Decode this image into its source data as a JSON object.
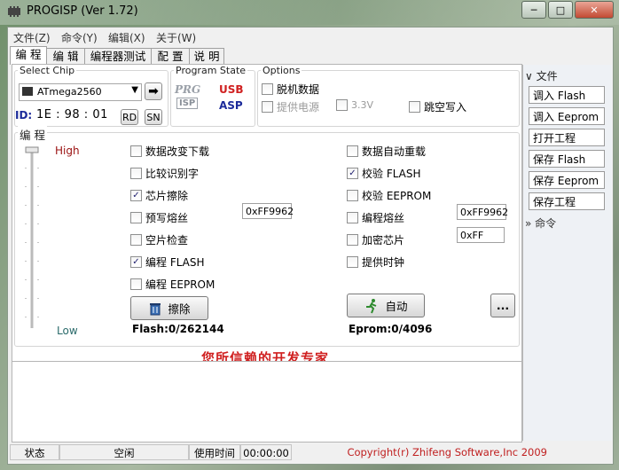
{
  "window": {
    "title": "PROGISP (Ver 1.72)",
    "min_label": "─",
    "max_label": "□",
    "close_label": "✕"
  },
  "menu": [
    "文件(Z)",
    "命令(Y)",
    "编辑(X)",
    "关于(W)"
  ],
  "tabs": [
    "编 程",
    "编 辑",
    "编程器测试",
    "配 置",
    "说 明"
  ],
  "chip": {
    "group_label": "Select Chip",
    "selected": "ATmega2560",
    "arrow_glyph": "➡",
    "id_label": "ID:",
    "id_value": "1E : 98 : 01",
    "rd_label": "RD",
    "sn_label": "SN"
  },
  "program_state": {
    "label": "Program State",
    "prg": "PRG",
    "isp": "ISP",
    "usb": "USB",
    "asp": "ASP"
  },
  "options": {
    "label": "Options",
    "offline": "脱机数据",
    "power": "提供电源",
    "v33": "3.3V",
    "jump": "跳空写入"
  },
  "program": {
    "group_label": "编 程",
    "high": "High",
    "low": "Low",
    "left_opts": [
      {
        "label": "数据改变下载",
        "checked": false
      },
      {
        "label": "比较识别字",
        "checked": false
      },
      {
        "label": "芯片擦除",
        "checked": true
      },
      {
        "label": "预写熔丝",
        "checked": false
      },
      {
        "label": "空片检查",
        "checked": false
      },
      {
        "label": "编程 FLASH",
        "checked": true
      },
      {
        "label": "编程 EEPROM",
        "checked": false
      }
    ],
    "right_opts": [
      {
        "label": "数据自动重载",
        "checked": false
      },
      {
        "label": "校验 FLASH",
        "checked": true
      },
      {
        "label": "校验 EEPROM",
        "checked": false
      },
      {
        "label": "编程熔丝",
        "checked": false
      },
      {
        "label": "加密芯片",
        "checked": false
      },
      {
        "label": "提供时钟",
        "checked": false
      }
    ],
    "prewrite_fuse_value": "0xFF9962",
    "fuse_value": "0xFF9962",
    "lock_value": "0xFF",
    "erase_label": "擦除",
    "auto_label": "自动",
    "more_label": "...",
    "flash_info": "Flash:0/262144",
    "eprom_info": "Eprom:0/4096"
  },
  "banner": "您所信赖的开发专家",
  "status": {
    "label": "状态",
    "value": "空闲",
    "time_label": "使用时间",
    "time_value": "00:00:00",
    "copyright": "Copyright(r) Zhifeng Software,Inc 2009"
  },
  "side": {
    "file_head": "文件",
    "buttons": [
      "调入 Flash",
      "调入 Eeprom",
      "打开工程",
      "保存 Flash",
      "保存 Eeprom",
      "保存工程"
    ],
    "cmd_head": "命令"
  },
  "colors": {
    "accent_red": "#d02020",
    "id_blue": "#1b2a9a",
    "high_red": "#9a1010",
    "low_teal": "#2a6a6a"
  }
}
